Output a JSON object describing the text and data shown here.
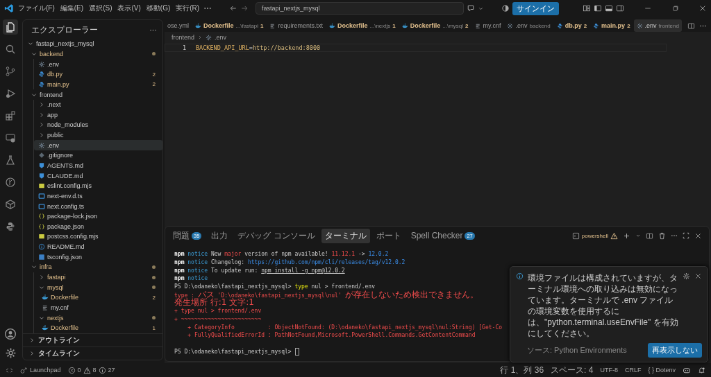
{
  "title_bar": {
    "menu": [
      "ファイル(F)",
      "編集(E)",
      "選択(S)",
      "表示(V)",
      "移動(G)",
      "実行(R)"
    ],
    "search": "fastapi_nextjs_mysql",
    "sign_in": "サインイン"
  },
  "activity": [
    {
      "kind": "files",
      "selected": true
    },
    {
      "kind": "search",
      "selected": false
    },
    {
      "kind": "branch",
      "selected": false
    },
    {
      "kind": "debug",
      "selected": false
    },
    {
      "kind": "extensions",
      "selected": false
    },
    {
      "kind": "remote",
      "selected": false
    },
    {
      "kind": "flask",
      "selected": false
    },
    {
      "kind": "graph",
      "selected": false
    },
    {
      "kind": "box",
      "selected": false
    },
    {
      "kind": "python",
      "selected": false
    }
  ],
  "explorer": {
    "title": "エクスプローラー",
    "tree": [
      {
        "name": "fastapi_nextjs_mysql",
        "kind": "folder",
        "expanded": true,
        "modified": false,
        "dot": false,
        "selected": false,
        "children": [
          {
            "name": "backend",
            "kind": "folder",
            "expanded": true,
            "modified": true,
            "dot": true,
            "selected": false,
            "children": [
              {
                "name": ".env",
                "kind": "gear",
                "modified": false,
                "selected": false
              },
              {
                "name": "db.py",
                "kind": "python",
                "modified": true,
                "badge": "2",
                "selected": false
              },
              {
                "name": "main.py",
                "kind": "python",
                "modified": true,
                "badge": "2",
                "selected": false
              }
            ]
          },
          {
            "name": "frontend",
            "kind": "folder",
            "expanded": true,
            "modified": false,
            "dot": false,
            "selected": false,
            "children": [
              {
                "name": ".next",
                "kind": "folder",
                "expanded": false,
                "modified": false,
                "dot": false,
                "selected": false
              },
              {
                "name": "app",
                "kind": "folder",
                "expanded": false,
                "modified": false,
                "dot": false,
                "selected": false
              },
              {
                "name": "node_modules",
                "kind": "folder",
                "expanded": false,
                "modified": false,
                "dot": false,
                "selected": false
              },
              {
                "name": "public",
                "kind": "folder",
                "expanded": false,
                "modified": false,
                "dot": false,
                "selected": false
              },
              {
                "name": ".env",
                "kind": "gear",
                "modified": false,
                "selected": true
              },
              {
                "name": ".gitignore",
                "kind": "git",
                "modified": false,
                "selected": false
              },
              {
                "name": "AGENTS.md",
                "kind": "markdown",
                "modified": false,
                "selected": false
              },
              {
                "name": "CLAUDE.md",
                "kind": "markdown",
                "modified": false,
                "selected": false
              },
              {
                "name": "eslint.config.mjs",
                "kind": "js",
                "modified": false,
                "selected": false
              },
              {
                "name": "next-env.d.ts",
                "kind": "ts",
                "modified": false,
                "selected": false
              },
              {
                "name": "next.config.ts",
                "kind": "ts",
                "modified": false,
                "selected": false
              },
              {
                "name": "package-lock.json",
                "kind": "json",
                "modified": false,
                "selected": false
              },
              {
                "name": "package.json",
                "kind": "json",
                "modified": false,
                "selected": false
              },
              {
                "name": "postcss.config.mjs",
                "kind": "js",
                "modified": false,
                "selected": false
              },
              {
                "name": "README.md",
                "kind": "info",
                "modified": false,
                "selected": false
              },
              {
                "name": "tsconfig.json",
                "kind": "tsconfig",
                "modified": false,
                "selected": false
              }
            ]
          },
          {
            "name": "infra",
            "kind": "folder",
            "expanded": true,
            "modified": true,
            "dot": true,
            "selected": false,
            "children": [
              {
                "name": "fastapi",
                "kind": "folder",
                "expanded": false,
                "modified": true,
                "dot": true,
                "selected": false
              },
              {
                "name": "mysql",
                "kind": "folder",
                "expanded": true,
                "modified": true,
                "dot": true,
                "selected": false,
                "children": [
                  {
                    "name": "Dockerfile",
                    "kind": "docker",
                    "modified": true,
                    "badge": "2",
                    "selected": false
                  },
                  {
                    "name": "my.cnf",
                    "kind": "lines",
                    "modified": false,
                    "selected": false
                  }
                ]
              },
              {
                "name": "nextjs",
                "kind": "folder",
                "expanded": true,
                "modified": true,
                "dot": true,
                "selected": false,
                "children": [
                  {
                    "name": "Dockerfile",
                    "kind": "docker",
                    "modified": true,
                    "badge": "1",
                    "selected": false
                  }
                ]
              }
            ]
          }
        ]
      }
    ],
    "sections": [
      {
        "label": "アウトライン",
        "expanded": false
      },
      {
        "label": "タイムライン",
        "expanded": false
      }
    ]
  },
  "tabs": [
    {
      "label": "ose.yml",
      "kind": "clipped",
      "modified": false,
      "selected": false
    },
    {
      "label": "Dockerfile",
      "description": "...\\fastapi",
      "badge": "1",
      "kind": "docker",
      "modified": true,
      "selected": false
    },
    {
      "label": "requirements.txt",
      "kind": "lines",
      "modified": false,
      "selected": false
    },
    {
      "label": "Dockerfile",
      "description": "...\\nextjs",
      "badge": "1",
      "kind": "docker",
      "modified": true,
      "selected": false
    },
    {
      "label": "Dockerfile",
      "description": "...\\mysql",
      "badge": "2",
      "kind": "docker",
      "modified": true,
      "selected": false
    },
    {
      "label": "my.cnf",
      "kind": "lines",
      "modified": false,
      "selected": false
    },
    {
      "label": ".env",
      "description": "backend",
      "kind": "gear",
      "modified": false,
      "selected": false
    },
    {
      "label": "db.py",
      "badge": "2",
      "kind": "python",
      "modified": true,
      "selected": false
    },
    {
      "label": "main.py",
      "badge": "2",
      "kind": "python",
      "modified": true,
      "selected": false
    },
    {
      "label": ".env",
      "description": "frontend",
      "kind": "gear",
      "modified": false,
      "selected": true
    }
  ],
  "breadcrumb": [
    "frontend",
    ".env"
  ],
  "editor": {
    "lines": [
      {
        "number": "1",
        "segments": [
          {
            "text": "BACKEND_API_URL",
            "kind": "key"
          },
          {
            "text": "=",
            "kind": "plain"
          },
          {
            "text": "http://backend:8000",
            "kind": "value"
          }
        ]
      }
    ]
  },
  "panel": {
    "tabs": [
      {
        "label": "問題",
        "count": "35",
        "selected": false
      },
      {
        "label": "出力",
        "selected": false
      },
      {
        "label": "デバッグ コンソール",
        "selected": false
      },
      {
        "label": "ターミナル",
        "selected": true
      },
      {
        "label": "ポート",
        "selected": false
      },
      {
        "label": "Spell Checker",
        "count": "27",
        "selected": false
      }
    ],
    "terminal_name": "powershell",
    "terminal": [
      {
        "segments": [
          {
            "text": "npm",
            "kind": "bold"
          },
          {
            "text": " notice",
            "kind": "notice"
          },
          {
            "text": " New ",
            "kind": "plain"
          },
          {
            "text": "major",
            "kind": "red"
          },
          {
            "text": " version of npm available! ",
            "kind": "plain"
          },
          {
            "text": "11.12.1",
            "kind": "red"
          },
          {
            "text": " -> ",
            "kind": "plain"
          },
          {
            "text": "12.0.2",
            "kind": "link"
          }
        ]
      },
      {
        "segments": [
          {
            "text": "npm",
            "kind": "bold"
          },
          {
            "text": " notice",
            "kind": "notice"
          },
          {
            "text": " Changelog: ",
            "kind": "plain"
          },
          {
            "text": "https://github.com/npm/cli/releases/tag/v12.0.2",
            "kind": "link"
          }
        ]
      },
      {
        "segments": [
          {
            "text": "npm",
            "kind": "bold"
          },
          {
            "text": " notice",
            "kind": "notice"
          },
          {
            "text": " To update run: ",
            "kind": "plain"
          },
          {
            "text": "npm install -g npm@12.0.2",
            "kind": "under"
          }
        ]
      },
      {
        "segments": [
          {
            "text": "npm",
            "kind": "bold"
          },
          {
            "text": " notice",
            "kind": "notice"
          }
        ]
      },
      {
        "segments": [
          {
            "text": "PS D:\\odaneko\\fastapi_nextjs_mysql> ",
            "kind": "plain"
          },
          {
            "text": "type",
            "kind": "cmd"
          },
          {
            "text": " nul > frontend/.env",
            "kind": "plain"
          }
        ]
      },
      {
        "segments": [
          {
            "text": "type : ",
            "kind": "red"
          },
          {
            "text": "パス",
            "kind": "wide"
          },
          {
            "text": " 'D:\\odaneko\\fastapi_nextjs_mysql\\nul' ",
            "kind": "red"
          },
          {
            "text": "が存在しないため検出できません。",
            "kind": "wide"
          }
        ]
      },
      {
        "segments": [
          {
            "text": "発生場所 行:1 文字:1",
            "kind": "wide"
          }
        ]
      },
      {
        "segments": [
          {
            "text": "+ type nul > frontend/.env",
            "kind": "red"
          }
        ]
      },
      {
        "segments": [
          {
            "text": "+ ~~~~~~~~~~~~~~~~~~~~~~~~",
            "kind": "red"
          }
        ]
      },
      {
        "segments": [
          {
            "text": "    + CategoryInfo          : ObjectNotFound: (D:\\odaneko\\fastapi_nextjs_mysql\\nul:String) [Get-Co",
            "kind": "red"
          }
        ]
      },
      {
        "segments": [
          {
            "text": "    + FullyQualifiedErrorId : PathNotFound,Microsoft.PowerShell.Commands.GetContentCommand",
            "kind": "red"
          }
        ]
      },
      {
        "kind": "blank"
      },
      {
        "segments": [
          {
            "text": "PS D:\\odaneko\\fastapi_nextjs_mysql> ",
            "kind": "plain"
          }
        ],
        "cursor": true
      }
    ]
  },
  "notification": {
    "message": "環境ファイルは構成されていますが、ターミナル環境への取り込みは無効になっています。ターミナルで .env ファイルの環境変数を使用するには、\"python.terminal.useEnvFile\" を有効にしてください。",
    "source": "ソース: Python Environments",
    "button": "再表示しない"
  },
  "status_bar": {
    "launchpad": "Launchpad",
    "errors": "0",
    "warnings": "8",
    "infos": "27",
    "position": "行 1、列 36",
    "indent": "スペース: 4",
    "encoding": "UTF-8",
    "eol": "CRLF",
    "language_icon": "{ }",
    "language": "Dotenv"
  }
}
